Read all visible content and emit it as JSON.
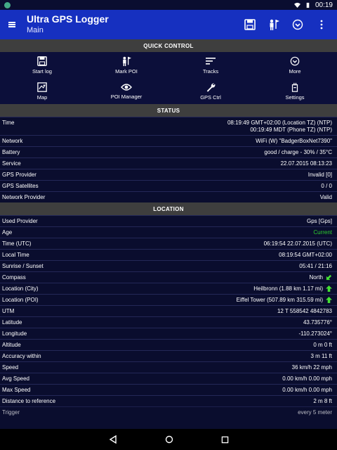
{
  "status_bar": {
    "time": "00:19"
  },
  "app_bar": {
    "title": "Ultra GPS Logger",
    "subtitle": "Main"
  },
  "quick_control": {
    "heading": "QUICK CONTROL",
    "items": [
      {
        "label": "Start log",
        "icon": "save-icon"
      },
      {
        "label": "Mark POI",
        "icon": "mark-poi-icon"
      },
      {
        "label": "Tracks",
        "icon": "tracks-icon"
      },
      {
        "label": "More",
        "icon": "more-icon"
      },
      {
        "label": "Map",
        "icon": "map-icon"
      },
      {
        "label": "POI Manager",
        "icon": "eye-icon"
      },
      {
        "label": "GPS Ctrl",
        "icon": "wrench-icon"
      },
      {
        "label": "Settings",
        "icon": "settings-icon"
      }
    ]
  },
  "status": {
    "heading": "STATUS",
    "time_label": "Time",
    "time_value_1": "08:19:49 GMT+02:00 (Location TZ) (NTP)",
    "time_value_2": "00:19:49 MDT (Phone TZ) (NTP)",
    "rows": [
      {
        "label": "Network",
        "value": "WiFi (W) \"BadgerBoxNet7390\""
      },
      {
        "label": "Battery",
        "value": "good / charge - 30% / 35°C"
      },
      {
        "label": "Service",
        "value": "22.07.2015 08:13:23"
      },
      {
        "label": "GPS Provider",
        "value": "Invalid [0]"
      },
      {
        "label": "GPS Satellites",
        "value": "0 / 0"
      },
      {
        "label": "Network Provider",
        "value": "Valid"
      }
    ]
  },
  "location": {
    "heading": "LOCATION",
    "rows": [
      {
        "label": "Used Provider",
        "value": "Gps [Gps]"
      },
      {
        "label": "Age",
        "value": "Current"
      },
      {
        "label": "Time (UTC)",
        "value": "06:19:54 22.07.2015 (UTC)"
      },
      {
        "label": "Local Time",
        "value": "08:19:54 GMT+02:00"
      },
      {
        "label": "Sunrise / Sunset",
        "value": "05:41 / 21:16"
      },
      {
        "label": "Compass",
        "value": "North"
      },
      {
        "label": "Location (City)",
        "value": "Heilbronn (1.88 km 1.17 mi)"
      },
      {
        "label": "Location (POI)",
        "value": "Eiffel Tower (507.89 km 315.59 mi)"
      },
      {
        "label": "UTM",
        "value": "12 T 558542 4842783"
      },
      {
        "label": "Latitude",
        "value": "43.735776°"
      },
      {
        "label": "Longitude",
        "value": "-110.273024°"
      },
      {
        "label": "Altitude",
        "value": "0 m   0 ft"
      },
      {
        "label": "Accuracy within",
        "value": "3 m   11 ft"
      },
      {
        "label": "Speed",
        "value": "36 km/h   22 mph"
      },
      {
        "label": "Avg Speed",
        "value": "0.00 km/h   0.00 mph"
      },
      {
        "label": "Max Speed",
        "value": "0.00 km/h   0.00 mph"
      },
      {
        "label": "Distance to reference",
        "value": "2 m   8 ft"
      },
      {
        "label": "Trigger",
        "value": "every 5 meter"
      }
    ]
  },
  "colors": {
    "app_bar": "#1630c0",
    "age_current": "#2ecf2e",
    "arrow": "#44e034"
  }
}
